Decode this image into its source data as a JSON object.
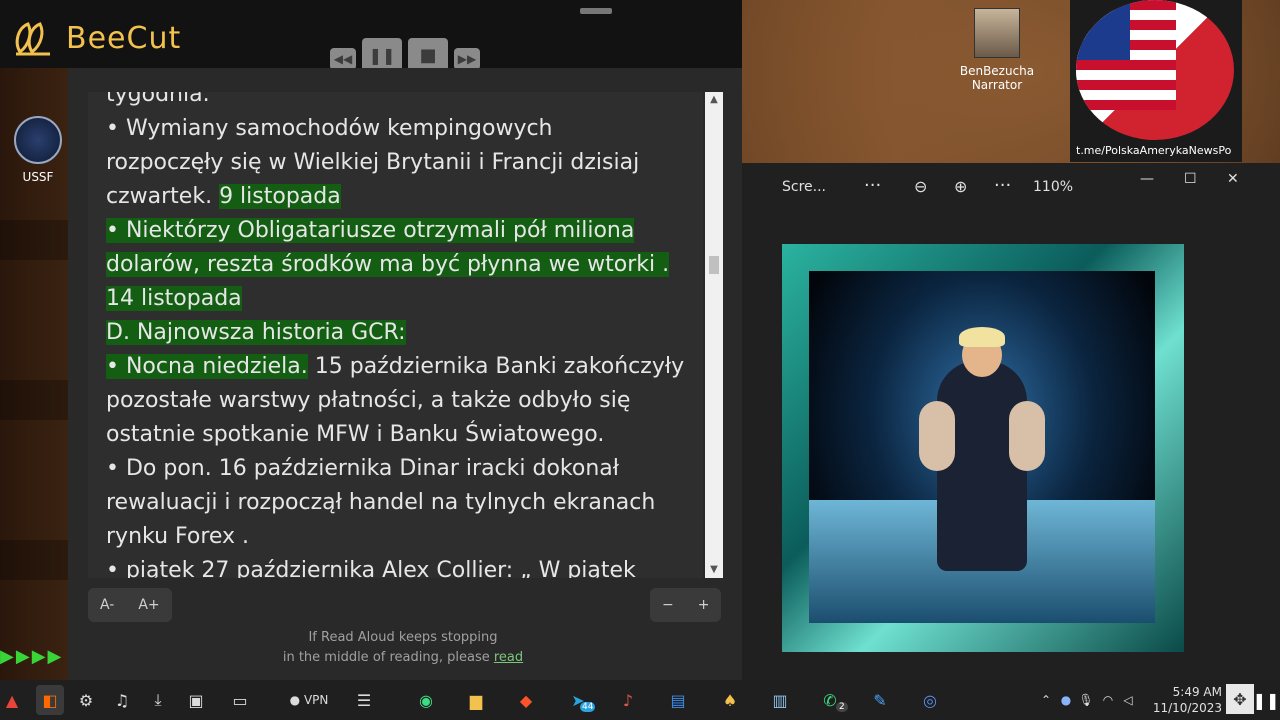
{
  "app": {
    "name": "BeeCut"
  },
  "player_controls": [
    {
      "name": "rewind-button",
      "glyph": "◀◀"
    },
    {
      "name": "pause-button",
      "glyph": "❚❚"
    },
    {
      "name": "stop-button",
      "glyph": "■"
    },
    {
      "name": "forward-button",
      "glyph": "▶▶"
    }
  ],
  "desktop": {
    "ussf_label": "USSF",
    "narrator_name": "BenBezucha",
    "narrator_role": "Narrator",
    "telegram_link": "t.me/PolskaAmerykaNewsPo"
  },
  "read_aloud": {
    "lines": [
      {
        "text": "tygodnia.",
        "hl": false
      },
      {
        "text": "• Wymiany samochodów kempingowych",
        "hl": false
      },
      {
        "text": "rozpoczęły się w Wielkiej Brytanii i Francji dzisiaj",
        "hl": false
      },
      {
        "text": "czwartek. ",
        "hl": false,
        "tail": "9 listopada",
        "tail_hl": true
      },
      {
        "text": "• Niektórzy Obligatariusze otrzymali pół miliona",
        "hl": true
      },
      {
        "text": "dolarów, reszta środków ma być płynna we wtorki .",
        "hl": true
      },
      {
        "text": "14 listopada",
        "hl": true
      },
      {
        "text": "D. Najnowsza historia GCR:",
        "hl": true
      },
      {
        "text": "• Nocna niedziela.",
        "hl": true,
        "tail": " 15 października Banki zakończyły",
        "tail_hl": false
      },
      {
        "text": "pozostałe warstwy płatności, a także odbyło się",
        "hl": false
      },
      {
        "text": "ostatnie spotkanie MFW i Banku Światowego.",
        "hl": false
      },
      {
        "text": "• Do pon. 16 października Dinar iracki dokonał",
        "hl": false
      },
      {
        "text": "rewaluacji i rozpoczął handel na tylnych ekranach",
        "hl": false
      },
      {
        "text": "rynku Forex .",
        "hl": false
      },
      {
        "text": "• piątek 27 października Alex Collier: „ W piątek",
        "hl": false
      }
    ],
    "font_decrease": "A-",
    "font_increase": "A+",
    "minus": "−",
    "plus": "+",
    "hint_line1": "If Read Aloud keeps stopping",
    "hint_line2": "in the middle of reading, please",
    "hint_link": "read"
  },
  "viewer": {
    "title": "Scre...",
    "more1": "···",
    "more2": "···",
    "zoom": "110%",
    "minimize": "—",
    "maximize": "☐",
    "close": "✕"
  },
  "taskbar": {
    "vpn_label": "VPN",
    "time": "5:49 AM",
    "date": "11/10/2023",
    "telegram_badge": "44",
    "whatsapp_badge": "2"
  },
  "colors": {
    "highlight": "#135e13",
    "accent": "#f2c14e"
  }
}
